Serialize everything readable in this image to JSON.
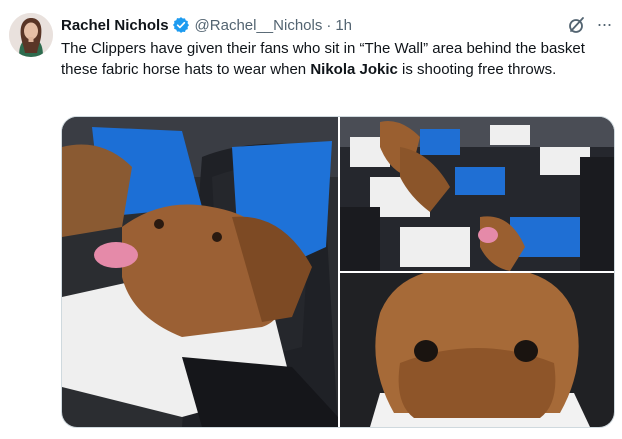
{
  "tweet": {
    "author_name": "Rachel Nichols",
    "handle": "@Rachel__Nichols",
    "separator": "·",
    "time": "1h",
    "text_part1": "The Clippers have given their fans who sit in “The Wall” area behind the basket these fabric horse hats to wear when ",
    "text_bold": "Nikola Jokic",
    "text_part2": " is shooting free throws.",
    "more_label": "···"
  },
  "icons": {
    "verified": "verified-badge-icon",
    "grok": "grok-icon",
    "more": "more-options-icon"
  },
  "colors": {
    "verified_blue": "#1d9bf0",
    "secondary_text": "#536471",
    "primary_text": "#0f1419",
    "border": "#cfd9de"
  }
}
